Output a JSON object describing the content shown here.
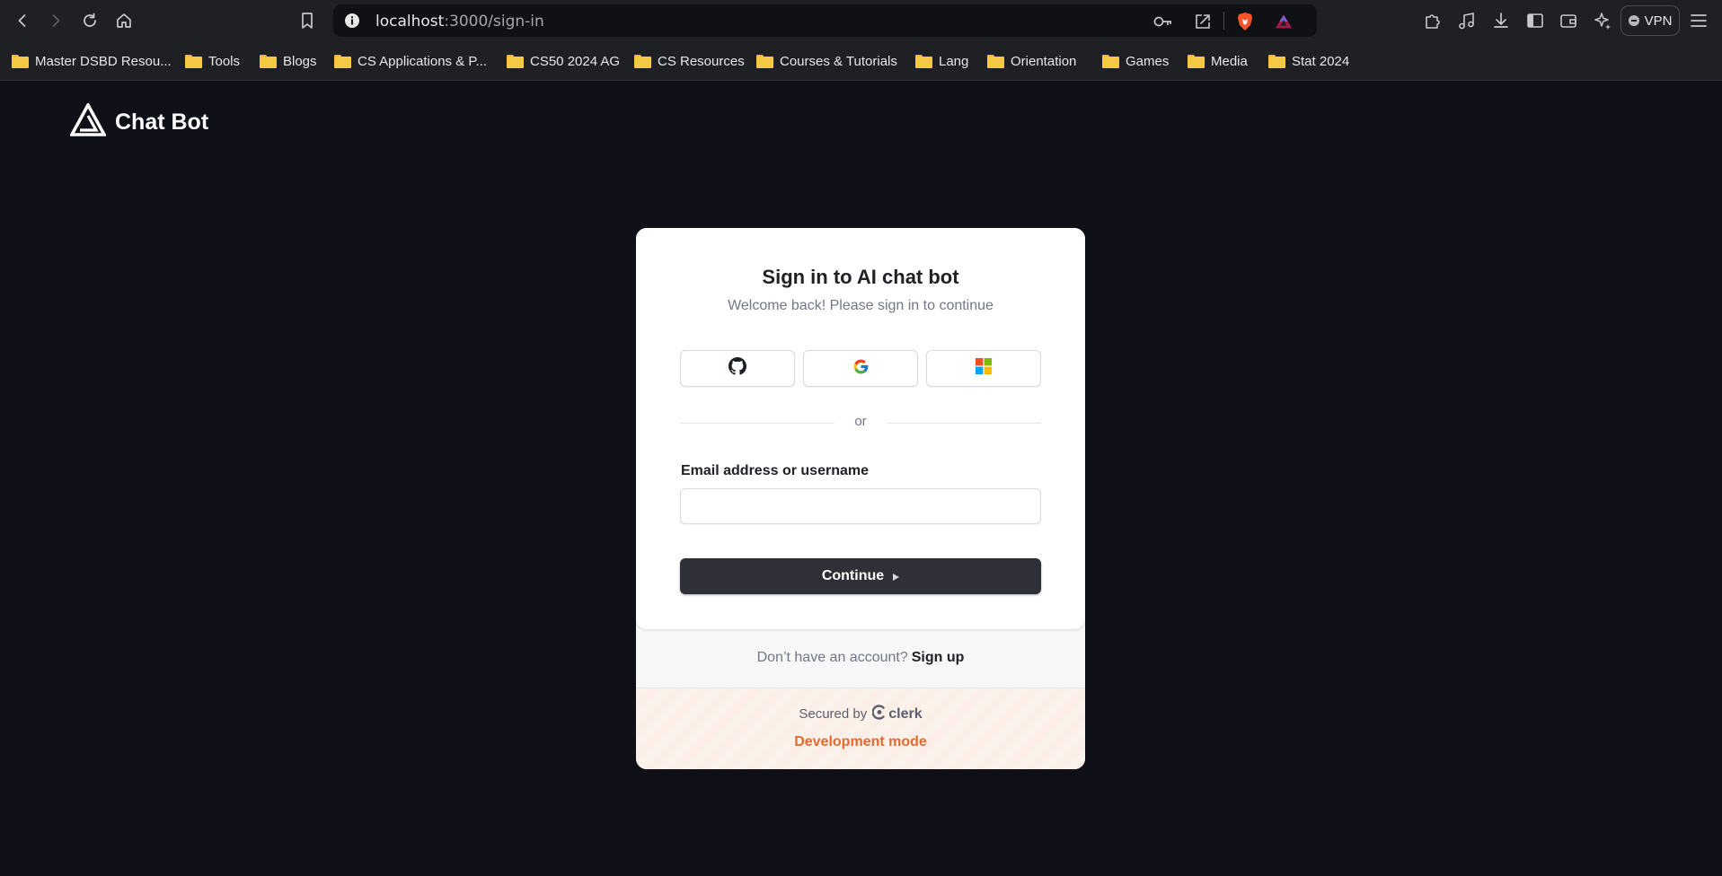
{
  "browser": {
    "url_host": "localhost",
    "url_path": ":3000/sign-in",
    "vpn_label": "VPN",
    "bookmarks": [
      "Master DSBD Resou...",
      "Tools",
      "Blogs",
      "CS Applications & P...",
      "CS50 2024 AG",
      "CS Resources",
      "Courses & Tutorials",
      "Lang",
      "Orientation",
      "Games",
      "Media",
      "Stat 2024"
    ]
  },
  "app": {
    "brand_name": "Chat Bot"
  },
  "sign_in": {
    "title": "Sign in to AI chat bot",
    "subtitle": "Welcome back! Please sign in to continue",
    "providers": [
      "github-icon",
      "google-icon",
      "microsoft-icon"
    ],
    "divider_text": "or",
    "email_label": "Email address or username",
    "email_value": "",
    "continue_label": "Continue",
    "no_account_text": "Don’t have an account?",
    "signup_label": "Sign up",
    "secured_by": "Secured by",
    "clerk_label": "clerk",
    "dev_mode": "Development mode"
  },
  "colors": {
    "page_bg": "#0f0f17",
    "button_bg": "#2f3037",
    "dev_mode": "#e36a2c"
  }
}
